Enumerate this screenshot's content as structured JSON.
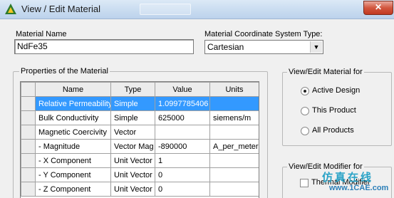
{
  "window": {
    "title": "View / Edit Material",
    "close_symbol": "✕",
    "icon": "ansys-logo-icon"
  },
  "material_name": {
    "label": "Material Name",
    "value": "NdFe35"
  },
  "coord_system": {
    "label": "Material Coordinate System Type:",
    "value": "Cartesian"
  },
  "properties": {
    "group_title": "Properties of the Material",
    "columns": [
      "Name",
      "Type",
      "Value",
      "Units"
    ],
    "rows": [
      {
        "name": "Relative Permeability",
        "type": "Simple",
        "value": "1.0997785406",
        "units": ""
      },
      {
        "name": "Bulk Conductivity",
        "type": "Simple",
        "value": "625000",
        "units": "siemens/m"
      },
      {
        "name": "Magnetic Coercivity",
        "type": "Vector",
        "value": "",
        "units": ""
      },
      {
        "name": "- Magnitude",
        "type": "Vector Mag",
        "value": "-890000",
        "units": "A_per_meter"
      },
      {
        "name": "- X Component",
        "type": "Unit Vector",
        "value": "1",
        "units": ""
      },
      {
        "name": "- Y Component",
        "type": "Unit Vector",
        "value": "0",
        "units": ""
      },
      {
        "name": "- Z Component",
        "type": "Unit Vector",
        "value": "0",
        "units": ""
      }
    ]
  },
  "view_edit_for": {
    "group_title": "View/Edit Material for",
    "options": [
      {
        "label": "Active Design",
        "selected": true
      },
      {
        "label": "This Product",
        "selected": false
      },
      {
        "label": "All Products",
        "selected": false
      }
    ]
  },
  "modifier_for": {
    "group_title": "View/Edit Modifier for",
    "thermal_label": "Thermal Modifier",
    "thermal_checked": false
  },
  "watermark": {
    "line1": "仿真在线",
    "line2": "www.1CAE.com"
  }
}
